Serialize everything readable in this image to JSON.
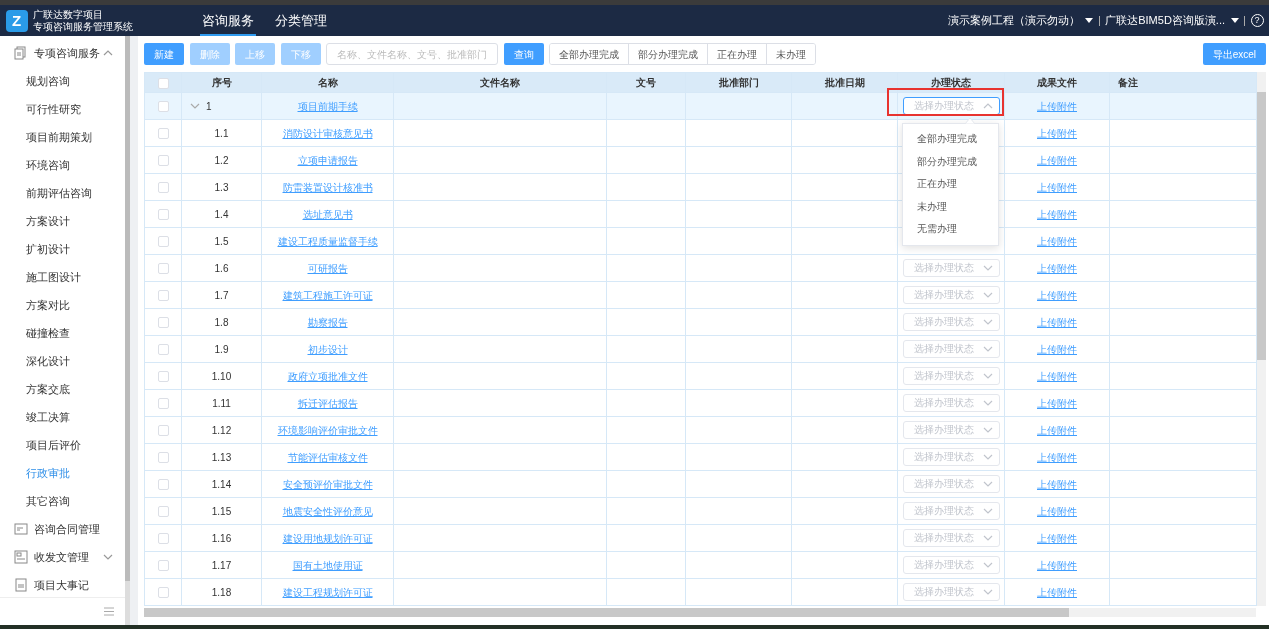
{
  "header": {
    "logo_letter": "Z",
    "app_title": "广联达数字项目",
    "app_subtitle": "专项咨询服务管理系统",
    "tabs": [
      {
        "label": "咨询服务",
        "selected": true
      },
      {
        "label": "分类管理",
        "selected": false
      }
    ],
    "project": "演示案例工程（演示勿动）",
    "organization": "广联达BIM5D咨询版演...",
    "help": "?"
  },
  "sidebar": {
    "items": [
      {
        "label": "专项咨询服务",
        "kind": "group",
        "expanded": true,
        "children": [
          {
            "label": "规划咨询",
            "selected": false
          },
          {
            "label": "可行性研究",
            "selected": false
          },
          {
            "label": "项目前期策划",
            "selected": false
          },
          {
            "label": "环境咨询",
            "selected": false
          },
          {
            "label": "前期评估咨询",
            "selected": false
          },
          {
            "label": "方案设计",
            "selected": false
          },
          {
            "label": "扩初设计",
            "selected": false
          },
          {
            "label": "施工图设计",
            "selected": false
          },
          {
            "label": "方案对比",
            "selected": false
          },
          {
            "label": "碰撞检查",
            "selected": false
          },
          {
            "label": "深化设计",
            "selected": false
          },
          {
            "label": "方案交底",
            "selected": false
          },
          {
            "label": "竣工决算",
            "selected": false
          },
          {
            "label": "项目后评价",
            "selected": false
          },
          {
            "label": "行政审批",
            "selected": true
          },
          {
            "label": "其它咨询",
            "selected": false
          }
        ]
      },
      {
        "label": "咨询合同管理",
        "kind": "link"
      },
      {
        "label": "收发文管理",
        "kind": "group",
        "expanded": false
      },
      {
        "label": "项目大事记",
        "kind": "link"
      }
    ]
  },
  "toolbar": {
    "buttons": [
      {
        "label": "新建",
        "disabled": false
      },
      {
        "label": "删除",
        "disabled": true
      },
      {
        "label": "上移",
        "disabled": true
      },
      {
        "label": "下移",
        "disabled": true
      }
    ],
    "search": {
      "placeholder": "名称、文件名称、文号、批准部门"
    },
    "search_button": "查询",
    "filters": [
      {
        "label": "全部办理完成",
        "selected": false
      },
      {
        "label": "部分办理完成",
        "selected": false
      },
      {
        "label": "正在办理",
        "selected": false
      },
      {
        "label": "未办理",
        "selected": false
      }
    ],
    "export_button": "导出excel"
  },
  "table": {
    "select_all_checked": false,
    "columns": [
      "序号",
      "名称",
      "文件名称",
      "文号",
      "批准部门",
      "批准日期",
      "办理状态",
      "成果文件",
      "备注"
    ],
    "rows": [
      {
        "index": "1",
        "name": "项目前期手续",
        "checked": false,
        "selected": true,
        "expanded": true,
        "annotated": true,
        "status_placeholder": "选择办理状态",
        "status_open": true,
        "result_link": "上传附件",
        "status_options": [
          "全部办理完成",
          "部分办理完成",
          "正在办理",
          "未办理",
          "无需办理"
        ],
        "children": [
          {
            "index": "1.1",
            "name": "消防设计审核意见书",
            "checked": false,
            "selected": false,
            "result_link": "上传附件"
          },
          {
            "index": "1.2",
            "name": "立项申请报告",
            "checked": false,
            "selected": false,
            "result_link": "上传附件"
          },
          {
            "index": "1.3",
            "name": "防雷装置设计核准书",
            "checked": false,
            "selected": false,
            "result_link": "上传附件"
          },
          {
            "index": "1.4",
            "name": "选址意见书",
            "checked": false,
            "selected": false,
            "result_link": "上传附件"
          },
          {
            "index": "1.5",
            "name": "建设工程质量监督手续",
            "checked": false,
            "selected": false,
            "result_link": "上传附件"
          },
          {
            "index": "1.6",
            "name": "可研报告",
            "checked": false,
            "selected": false,
            "status_placeholder": "选择办理状态",
            "status_open": false,
            "result_link": "上传附件"
          },
          {
            "index": "1.7",
            "name": "建筑工程施工许可证",
            "checked": false,
            "selected": false,
            "status_placeholder": "选择办理状态",
            "status_open": false,
            "result_link": "上传附件"
          },
          {
            "index": "1.8",
            "name": "勘察报告",
            "checked": false,
            "selected": false,
            "status_placeholder": "选择办理状态",
            "status_open": false,
            "result_link": "上传附件"
          },
          {
            "index": "1.9",
            "name": "初步设计",
            "checked": false,
            "selected": false,
            "status_placeholder": "选择办理状态",
            "status_open": false,
            "result_link": "上传附件"
          },
          {
            "index": "1.10",
            "name": "政府立项批准文件",
            "checked": false,
            "selected": false,
            "status_placeholder": "选择办理状态",
            "status_open": false,
            "result_link": "上传附件"
          },
          {
            "index": "1.11",
            "name": "拆迁评估报告",
            "checked": false,
            "selected": false,
            "status_placeholder": "选择办理状态",
            "status_open": false,
            "result_link": "上传附件"
          },
          {
            "index": "1.12",
            "name": "环境影响评价审批文件",
            "checked": false,
            "selected": false,
            "status_placeholder": "选择办理状态",
            "status_open": false,
            "result_link": "上传附件"
          },
          {
            "index": "1.13",
            "name": "节能评估审核文件",
            "checked": false,
            "selected": false,
            "status_placeholder": "选择办理状态",
            "status_open": false,
            "result_link": "上传附件"
          },
          {
            "index": "1.14",
            "name": "安全预评价审批文件",
            "checked": false,
            "selected": false,
            "status_placeholder": "选择办理状态",
            "status_open": false,
            "result_link": "上传附件"
          },
          {
            "index": "1.15",
            "name": "地震安全性评价意见",
            "checked": false,
            "selected": false,
            "status_placeholder": "选择办理状态",
            "status_open": false,
            "result_link": "上传附件"
          },
          {
            "index": "1.16",
            "name": "建设用地规划许可证",
            "checked": false,
            "selected": false,
            "status_placeholder": "选择办理状态",
            "status_open": false,
            "result_link": "上传附件"
          },
          {
            "index": "1.17",
            "name": "国有土地使用证",
            "checked": false,
            "selected": false,
            "status_placeholder": "选择办理状态",
            "status_open": false,
            "result_link": "上传附件"
          },
          {
            "index": "1.18",
            "name": "建设工程规划许可证",
            "checked": false,
            "selected": false,
            "status_placeholder": "选择办理状态",
            "status_open": false,
            "result_link": "上传附件"
          }
        ]
      }
    ]
  }
}
